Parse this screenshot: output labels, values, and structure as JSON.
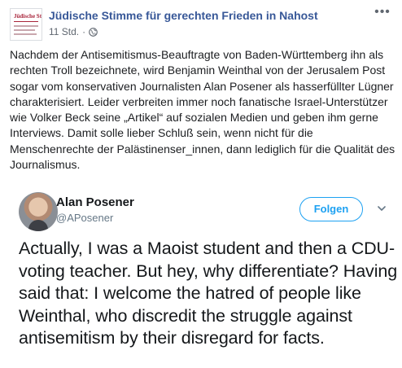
{
  "post": {
    "page_name": "Jüdische Stimme für gerechten Frieden in Nahost",
    "timestamp": "11 Std.",
    "separator": "·",
    "privacy_icon": "globe-icon",
    "options_icon": "more-icon",
    "body": "Nachdem der Antisemitismus-Beauftragte von Baden-Württemberg ihn als rechten Troll bezeichnete, wird Benjamin Weinthal von der Jerusalem Post sogar vom konservativen Journalisten Alan Posener als hasserfüllter Lügner charakterisiert. Leider verbreiten immer noch fanatische Israel-Unterstützer wie Volker Beck seine „Artikel“ auf sozialen Medien und geben ihm gerne Interviews. Damit solle lieber Schluß sein, wenn nicht für die Menschenrechte der Palästinenser_innen, dann lediglich für die Qualität des Journalismus."
  },
  "tweet": {
    "author_name": "Alan Posener",
    "author_handle": "@APosener",
    "follow_label": "Folgen",
    "text": "Actually, I was a Maoist student and then a CDU-voting teacher. But hey, why differentiate? Having said that: I welcome the hatred of people like Weinthal, who discredit the struggle against antisemitism by their disregard for facts."
  },
  "colors": {
    "link_blue": "#385898",
    "twitter_blue": "#1da1f2",
    "meta_gray": "#606770"
  }
}
